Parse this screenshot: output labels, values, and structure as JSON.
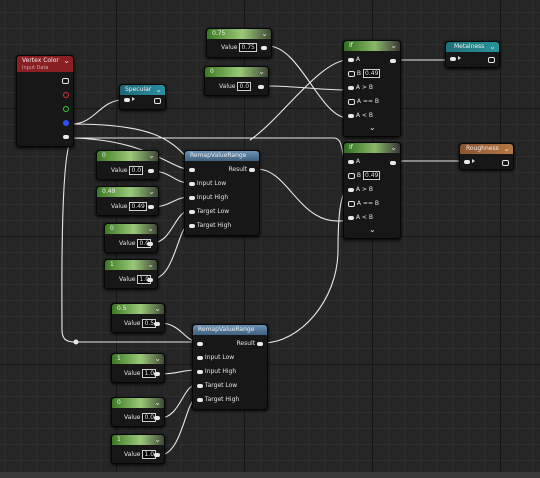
{
  "vertex_color": {
    "title": "Vertex Color",
    "subtitle": "Input Data"
  },
  "specular": {
    "title": "Specular"
  },
  "param_075": {
    "title": "0.75",
    "value_label": "Value",
    "value": "0.75"
  },
  "param_0a": {
    "title": "0",
    "value_label": "Value",
    "value": "0.0"
  },
  "if_top": {
    "title": "If",
    "a": "A",
    "b": "B",
    "b_value": "0.49",
    "a_gt_b": "A > B",
    "a_eq_b": "A == B",
    "a_lt_b": "A < B"
  },
  "if_bottom": {
    "title": "If",
    "a": "A",
    "b": "B",
    "b_value": "0.49",
    "a_gt_b": "A > B",
    "a_eq_b": "A == B",
    "a_lt_b": "A < B"
  },
  "metalness": {
    "title": "Metalness"
  },
  "roughness": {
    "title": "Roughness"
  },
  "remap1": {
    "title": "RemapValueRange",
    "result": "Result",
    "input_low": "Input Low",
    "input_high": "Input High",
    "target_low": "Target Low",
    "target_high": "Target High"
  },
  "remap2": {
    "title": "RemapValueRange",
    "result": "Result",
    "input_low": "Input Low",
    "input_high": "Input High",
    "target_low": "Target Low",
    "target_high": "Target High"
  },
  "p1": {
    "title": "0",
    "value_label": "Value",
    "value": "0.0"
  },
  "p2": {
    "title": "0.49",
    "value_label": "Value",
    "value": "0.49"
  },
  "p3": {
    "title": "0",
    "value_label": "Value",
    "value": "0.0"
  },
  "p4": {
    "title": "1",
    "value_label": "Value",
    "value": "1.0"
  },
  "p5": {
    "title": "0.5",
    "value_label": "Value",
    "value": "0.5"
  },
  "p6": {
    "title": "1",
    "value_label": "Value",
    "value": "1.0"
  },
  "p7": {
    "title": "0",
    "value_label": "Value",
    "value": "0.0"
  },
  "p8": {
    "title": "1",
    "value_label": "Value",
    "value": "1.0"
  },
  "chevron": "⌄"
}
